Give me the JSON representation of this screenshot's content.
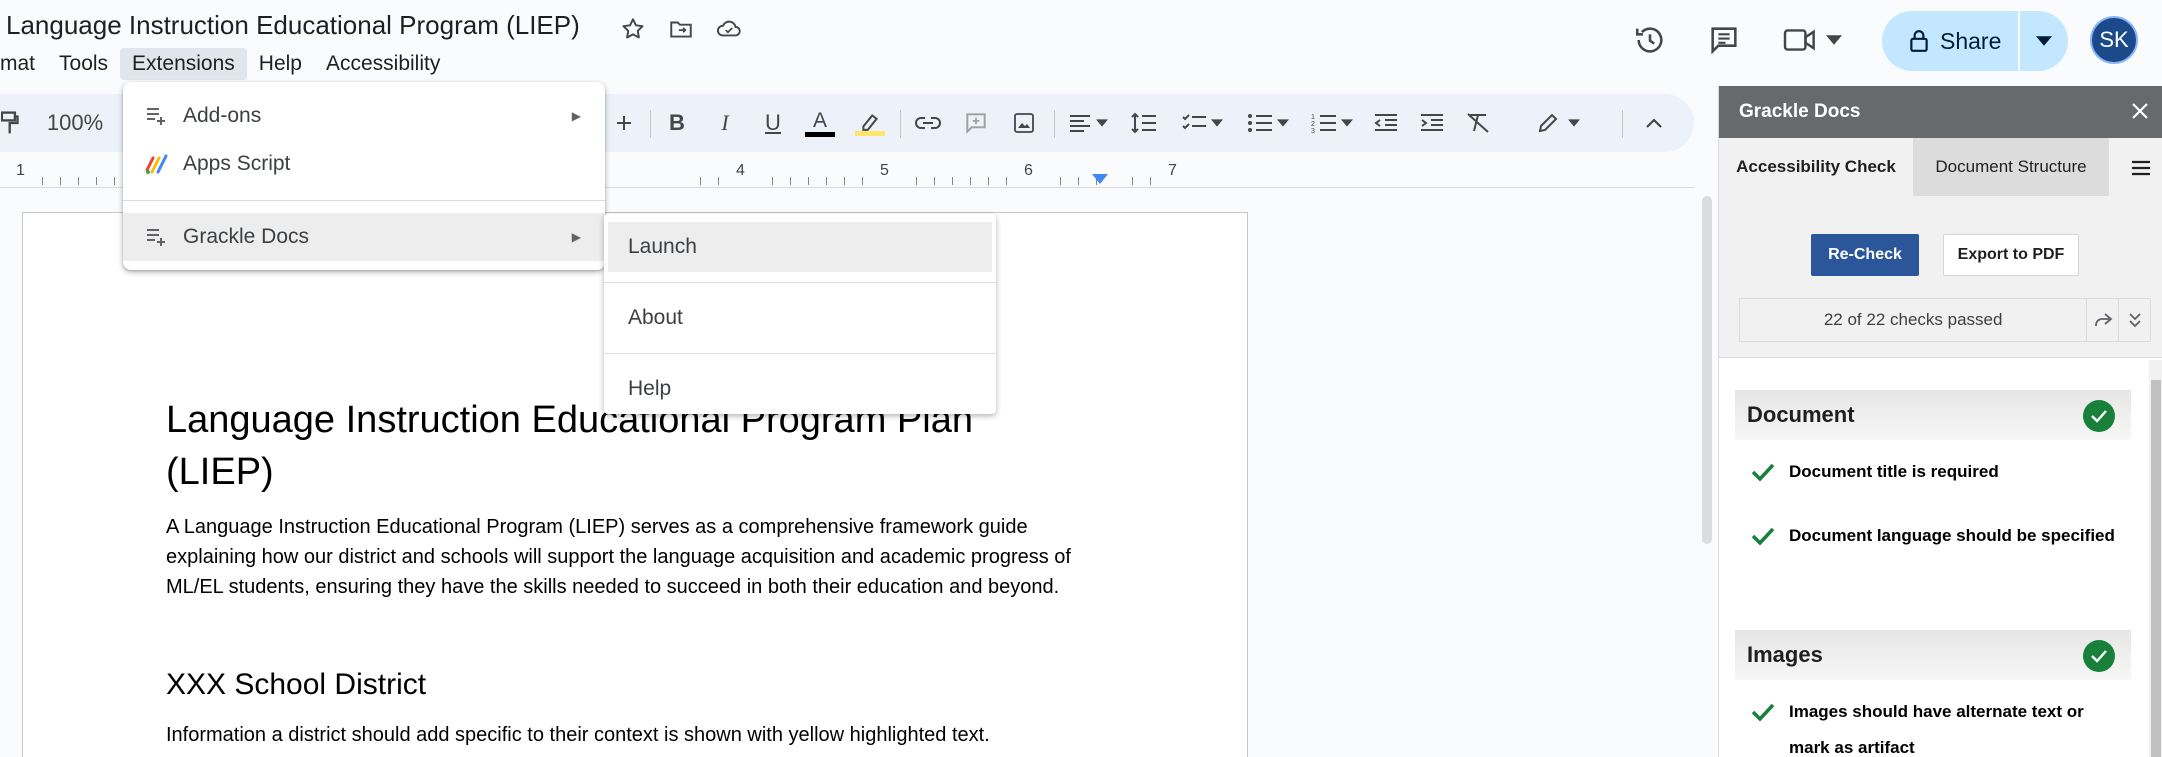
{
  "doc": {
    "title": "Language Instruction Educational Program (LIEP)"
  },
  "menubar": {
    "items": [
      "mat",
      "Tools",
      "Extensions",
      "Help",
      "Accessibility"
    ]
  },
  "share": {
    "label": "Share"
  },
  "avatar": {
    "initials": "SK"
  },
  "toolbar": {
    "zoom": "100%"
  },
  "ruler": {
    "numbers": [
      "1",
      "4",
      "5",
      "6",
      "7"
    ]
  },
  "extensions_menu": {
    "items": [
      {
        "label": "Add-ons",
        "icon": "addon-icon",
        "has_submenu": true
      },
      {
        "label": "Apps Script",
        "icon": "apps-script-icon",
        "has_submenu": false
      },
      {
        "label": "Grackle Docs",
        "icon": "addon-icon",
        "has_submenu": true,
        "highlighted": true
      }
    ]
  },
  "grackle_submenu": {
    "items": [
      "Launch",
      "About",
      "Help"
    ]
  },
  "document_body": {
    "heading": "Language Instruction Educational Program Plan (LIEP)",
    "para1": "A Language Instruction Educational Program (LIEP) serves as a comprehensive framework guide explaining how our district and schools will support the language acquisition and academic progress of ML/EL students, ensuring they have the skills needed to succeed in both their education and beyond.",
    "heading2": "XXX School District",
    "para2": "Information a district should add specific to their context is shown with yellow highlighted text."
  },
  "panel": {
    "title": "Grackle Docs",
    "tabs": [
      "Accessibility Check",
      "Document Structure"
    ],
    "recheck_label": "Re-Check",
    "export_label": "Export to PDF",
    "status": "22 of 22 checks passed",
    "sections": [
      {
        "title": "Document",
        "checks": [
          "Document title is required",
          "Document language should be specified"
        ]
      },
      {
        "title": "Images",
        "checks": [
          "Images should have alternate text or mark as artifact"
        ]
      }
    ]
  },
  "colors": {
    "accent": "#2b579a",
    "share_bg": "#c2e7ff",
    "panel_header": "#666a6d",
    "pass_green": "#188038"
  }
}
